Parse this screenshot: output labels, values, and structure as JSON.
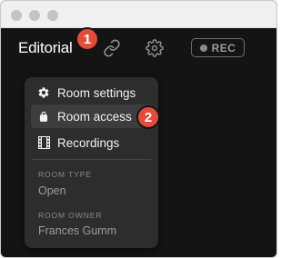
{
  "window": {
    "controls": [
      "close",
      "minimize",
      "zoom"
    ]
  },
  "header": {
    "room_title": "Editorial",
    "link_icon": "link-icon",
    "settings_icon": "gear-icon",
    "rec_label": "REC"
  },
  "annotations": [
    "1",
    "2"
  ],
  "menu": {
    "items": [
      {
        "label": "Room settings",
        "icon": "gear-icon"
      },
      {
        "label": "Room access",
        "icon": "lock-icon",
        "highlighted": true
      },
      {
        "label": "Recordings",
        "icon": "film-icon"
      }
    ],
    "info": [
      {
        "label": "ROOM TYPE",
        "value": "Open"
      },
      {
        "label": "ROOM OWNER",
        "value": "Frances Gumm"
      }
    ]
  },
  "colors": {
    "background": "#141414",
    "menu_background": "#2d2d2d",
    "menu_highlight": "#3d3d3d",
    "badge": "#e14c3c"
  }
}
